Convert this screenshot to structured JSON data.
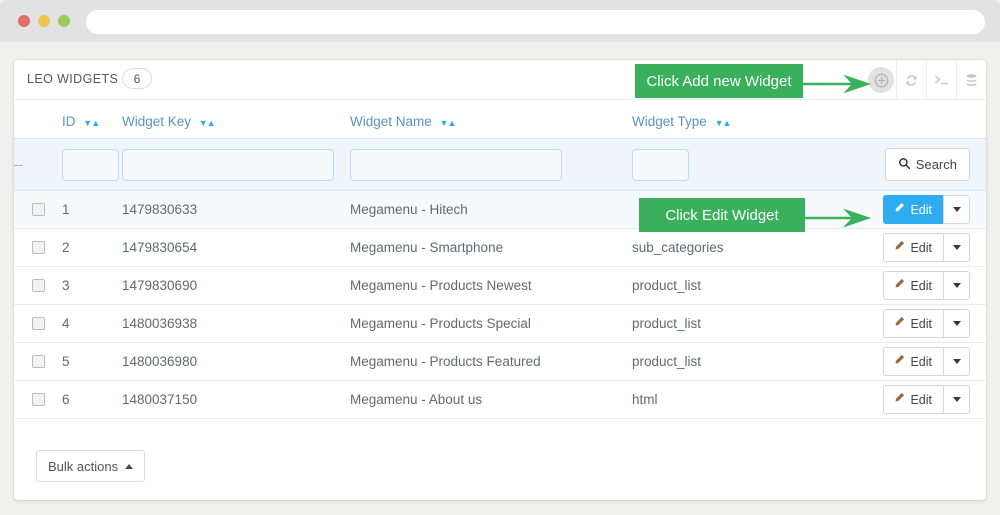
{
  "browser": {
    "traffic_lights": [
      "close",
      "minimize",
      "maximize"
    ],
    "address_value": "",
    "address_placeholder": ""
  },
  "panel": {
    "title": "LEO WIDGETS",
    "count": "6",
    "tools": [
      {
        "name": "add-new-widget-icon",
        "label": "Add new widget"
      },
      {
        "name": "refresh-icon",
        "label": "Refresh"
      },
      {
        "name": "terminal-icon",
        "label": ">_"
      },
      {
        "name": "database-icon",
        "label": "Database"
      }
    ]
  },
  "table": {
    "columns": [
      {
        "key": "checkbox",
        "label": ""
      },
      {
        "key": "id",
        "label": "ID",
        "sortable": true
      },
      {
        "key": "widget_key",
        "label": "Widget Key",
        "sortable": true
      },
      {
        "key": "widget_name",
        "label": "Widget Name",
        "sortable": true
      },
      {
        "key": "widget_type",
        "label": "Widget Type",
        "sortable": true
      },
      {
        "key": "actions",
        "label": ""
      }
    ],
    "filter_row": {
      "dash": "--",
      "id_value": "",
      "key_value": "",
      "name_value": "",
      "type_value": "",
      "search_label": "Search"
    },
    "rows": [
      {
        "id": "1",
        "widget_key": "1479830633",
        "widget_name": "Megamenu - Hitech",
        "widget_type": "",
        "edit_label": "Edit",
        "highlighted": true
      },
      {
        "id": "2",
        "widget_key": "1479830654",
        "widget_name": "Megamenu - Smartphone",
        "widget_type": "sub_categories",
        "edit_label": "Edit",
        "highlighted": false
      },
      {
        "id": "3",
        "widget_key": "1479830690",
        "widget_name": "Megamenu - Products Newest",
        "widget_type": "product_list",
        "edit_label": "Edit",
        "highlighted": false
      },
      {
        "id": "4",
        "widget_key": "1480036938",
        "widget_name": "Megamenu - Products Special",
        "widget_type": "product_list",
        "edit_label": "Edit",
        "highlighted": false
      },
      {
        "id": "5",
        "widget_key": "1480036980",
        "widget_name": "Megamenu - Products Featured",
        "widget_type": "product_list",
        "edit_label": "Edit",
        "highlighted": false
      },
      {
        "id": "6",
        "widget_key": "1480037150",
        "widget_name": "Megamenu - About us",
        "widget_type": "html",
        "edit_label": "Edit",
        "highlighted": false
      }
    ]
  },
  "footer": {
    "bulk_actions_label": "Bulk actions"
  },
  "callouts": [
    {
      "id": "add",
      "text": "Click Add new Widget"
    },
    {
      "id": "edit",
      "text": "Click Edit Widget"
    }
  ],
  "colors": {
    "callout_green": "#3aaf5c",
    "accent_blue": "#2eacef",
    "header_link_blue": "#5a93bf",
    "filter_row_bg": "#eef6fb"
  }
}
